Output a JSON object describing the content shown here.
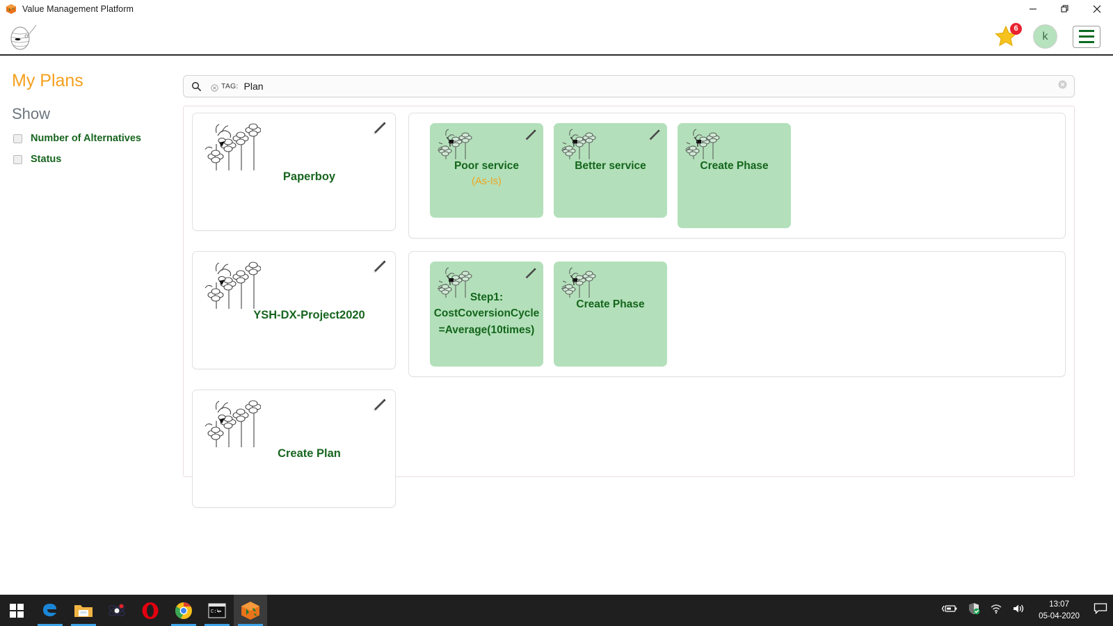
{
  "window": {
    "title": "Value Management Platform",
    "icon": "app-cube-icon",
    "controls": {
      "minimize": "minimize-icon",
      "maximize": "maximize-icon",
      "close": "close-icon"
    }
  },
  "header": {
    "logo": "cocoon-logo",
    "favorites": {
      "icon": "star-icon",
      "badge_count": "6"
    },
    "avatar": {
      "initial": "k"
    },
    "menu": {
      "icon": "hamburger-menu-icon"
    }
  },
  "sidebar": {
    "title": "My Plans",
    "section_label": "Show",
    "filters": [
      {
        "label": "Number of Alternatives",
        "checked": false
      },
      {
        "label": "Status",
        "checked": false
      }
    ]
  },
  "search": {
    "icon": "search-icon",
    "tag_remove_icon": "remove-tag-icon",
    "tag_label": "TAG:",
    "tag_value": "Plan",
    "clear_icon": "clear-search-icon",
    "placeholder": ""
  },
  "plans": [
    {
      "name": "Paperboy",
      "edit_icon": "pencil-icon",
      "logo": "ant-trees-logo",
      "phases": [
        {
          "name": "Poor service",
          "subtitle": "(As-Is)",
          "edit_icon": "pencil-icon",
          "logo": "ant-trees-logo"
        },
        {
          "name": "Better service",
          "subtitle": "",
          "edit_icon": "pencil-icon",
          "logo": "ant-trees-logo"
        },
        {
          "name": "Create Phase",
          "subtitle": "",
          "edit_icon": "",
          "logo": "ant-trees-logo"
        }
      ]
    },
    {
      "name": "YSH-DX-Project2020",
      "edit_icon": "pencil-icon",
      "logo": "ant-trees-logo",
      "phases": [
        {
          "name": "Step1: CostCoversionCycle =Average(10times)",
          "subtitle": "",
          "edit_icon": "pencil-icon",
          "logo": "ant-trees-logo"
        },
        {
          "name": "Create Phase",
          "subtitle": "",
          "edit_icon": "",
          "logo": "ant-trees-logo"
        }
      ]
    },
    {
      "name": "Create Plan",
      "edit_icon": "pencil-icon",
      "logo": "ant-trees-logo",
      "phases": []
    }
  ],
  "taskbar": {
    "apps": [
      {
        "name": "start-button",
        "icon": "windows-logo-icon",
        "active": false
      },
      {
        "name": "edge-button",
        "icon": "edge-icon",
        "active": false
      },
      {
        "name": "file-explorer-button",
        "icon": "folder-icon",
        "active": false
      },
      {
        "name": "atom-app-button",
        "icon": "atom-icon",
        "active": false
      },
      {
        "name": "opera-button",
        "icon": "opera-icon",
        "active": false
      },
      {
        "name": "chrome-button",
        "icon": "chrome-icon",
        "active": false
      },
      {
        "name": "command-prompt-button",
        "icon": "terminal-icon",
        "active": false
      },
      {
        "name": "vmp-app-button",
        "icon": "app-cube-icon",
        "active": true
      }
    ],
    "tray": {
      "battery_icon": "battery-charging-icon",
      "security_icon": "defender-shield-icon",
      "network_icon": "wifi-icon",
      "volume_icon": "speaker-icon",
      "time": "13:07",
      "date": "05-04-2020",
      "action_center_icon": "notification-icon"
    }
  },
  "colors": {
    "accent_orange": "#f5a01e",
    "brand_green": "#17651f",
    "phase_green_bg": "#b3e0ba",
    "badge_red": "#e8222e",
    "taskbar_bg": "#1f1f1f"
  }
}
